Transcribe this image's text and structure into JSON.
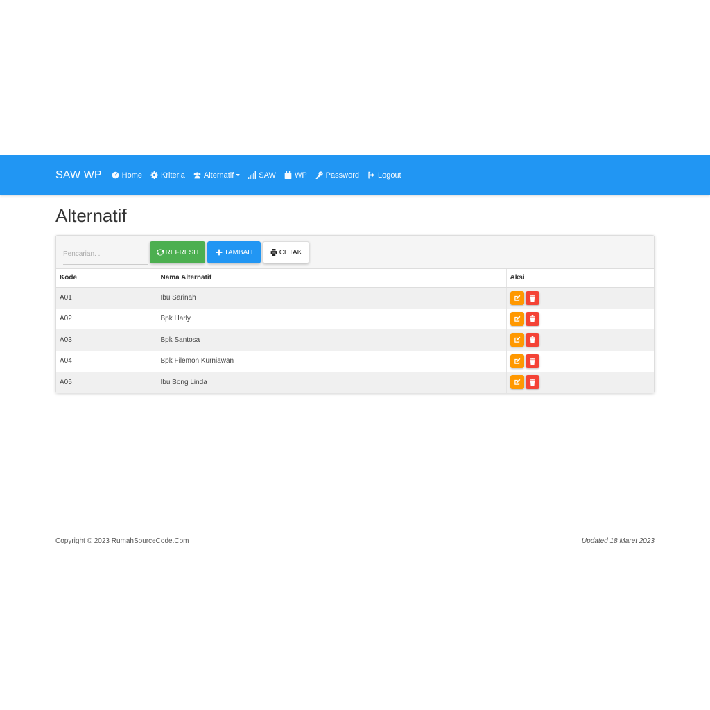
{
  "navbar": {
    "brand": "SAW WP",
    "items": [
      {
        "label": "Home",
        "icon": "dashboard-icon"
      },
      {
        "label": "Kriteria",
        "icon": "gear-icon"
      },
      {
        "label": "Alternatif",
        "icon": "users-icon",
        "dropdown": true
      },
      {
        "label": "SAW",
        "icon": "signal-icon"
      },
      {
        "label": "WP",
        "icon": "calendar-icon"
      },
      {
        "label": "Password",
        "icon": "key-icon"
      },
      {
        "label": "Logout",
        "icon": "sign-out-icon"
      }
    ]
  },
  "page": {
    "title": "Alternatif"
  },
  "toolbar": {
    "search_placeholder": "Pencarian. . .",
    "refresh_label": "REFRESH",
    "tambah_label": "TAMBAH",
    "cetak_label": "CETAK"
  },
  "table": {
    "headers": [
      "Kode",
      "Nama Alternatif",
      "Aksi"
    ],
    "rows": [
      {
        "kode": "A01",
        "nama": "Ibu Sarinah"
      },
      {
        "kode": "A02",
        "nama": "Bpk Harly"
      },
      {
        "kode": "A03",
        "nama": "Bpk Santosa"
      },
      {
        "kode": "A04",
        "nama": "Bpk Filemon Kurniawan"
      },
      {
        "kode": "A05",
        "nama": "Ibu Bong Linda"
      }
    ]
  },
  "footer": {
    "copyright": "Copyright © 2023 RumahSourceCode.Com",
    "updated": "Updated 18 Maret 2023"
  },
  "colors": {
    "navbar": "#2196f3",
    "refresh": "#4caf50",
    "tambah": "#2196f3",
    "edit": "#ff9800",
    "delete": "#f44336"
  }
}
